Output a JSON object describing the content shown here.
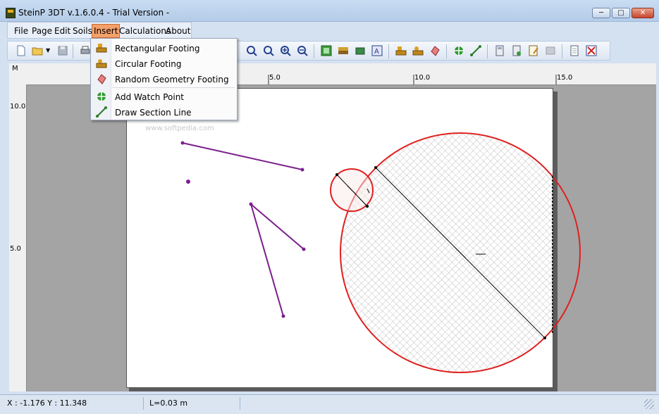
{
  "window": {
    "title": "SteinP 3DT v.1.6.0.4 - Trial Version -"
  },
  "window_controls": {
    "minimize": "─",
    "maximize": "□",
    "close": "✕"
  },
  "menubar": {
    "items": [
      {
        "label": "File"
      },
      {
        "label": "Page"
      },
      {
        "label": "Edit"
      },
      {
        "label": "Soils"
      },
      {
        "label": "Insert",
        "active": true
      },
      {
        "label": "Calculations"
      },
      {
        "label": "About"
      }
    ]
  },
  "insert_menu": {
    "items": [
      {
        "label": "Rectangular Footing",
        "icon": "rectangular-footing-icon"
      },
      {
        "label": "Circular Footing",
        "icon": "circular-footing-icon"
      },
      {
        "label": "Random Geometry Footing",
        "icon": "random-geometry-footing-icon"
      },
      {
        "label": "Add Watch Point",
        "icon": "watch-point-icon"
      },
      {
        "label": "Draw Section Line",
        "icon": "section-line-icon"
      }
    ]
  },
  "toolbar": {
    "icons": [
      "new-file-icon",
      "open-folder-icon",
      "save-icon",
      "print-icon",
      "zoom-window-icon",
      "zoom-all-icon",
      "zoom-in-icon",
      "zoom-out-icon",
      "grid-icon",
      "soil-layer-icon",
      "footing-view-icon",
      "text-label-icon",
      "rectangular-footing-icon",
      "circular-footing-icon",
      "random-footing-icon",
      "watch-point-icon",
      "section-line-icon",
      "calculator-icon",
      "calc-settings-icon",
      "report-icon",
      "disabled-tool-icon",
      "document-icon",
      "clear-icon"
    ]
  },
  "ruler": {
    "unit": "M",
    "top_labels": [
      "5.0",
      "10.0",
      "15.0"
    ],
    "left_labels": [
      "10.0",
      "5.0"
    ]
  },
  "canvas": {
    "watermark": "www.softpedia.com"
  },
  "status": {
    "coords": "X : -1.176 Y : 11.348",
    "length": "L=0.03 m"
  },
  "colors": {
    "accent_menu": "#f4a06a",
    "polyline": "#7b1f8c",
    "footing_outline": "#e02020",
    "hatch": "#9a9a9a"
  }
}
